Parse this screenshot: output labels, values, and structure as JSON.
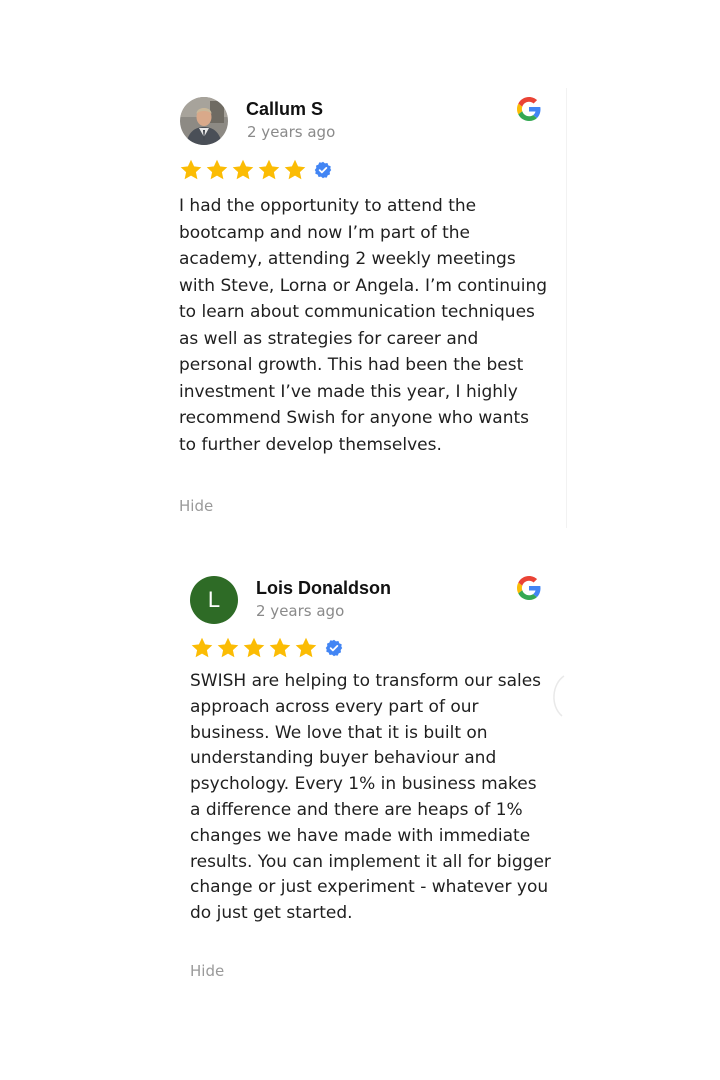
{
  "reviews": [
    {
      "author": "Callum S",
      "date": "2 years ago",
      "rating": 5,
      "verified_icon": "verified-badge-icon",
      "source_icon": "google-logo-icon",
      "text": "I had the opportunity to attend the bootcamp and now I’m part of the academy, attending 2 weekly meetings with Steve, Lorna or Angela. I’m continuing to learn about communication techniques as well as strategies for career and personal growth. This had been the best investment I’ve made this year, I highly recommend Swish for anyone who wants to further develop themselves.",
      "hide_label": "Hide"
    },
    {
      "author": "Lois Donaldson",
      "date": "2 years ago",
      "avatar_letter": "L",
      "avatar_color": "#2e6b26",
      "rating": 5,
      "verified_icon": "verified-badge-icon",
      "source_icon": "google-logo-icon",
      "text": "SWISH are helping to transform our sales approach across every part of our business. We love that it is built on understanding buyer behaviour and psychology. Every 1% in business makes a difference and there are heaps of 1% changes we have made with immediate results. You can implement it all for bigger change or just experiment - whatever you do just get started.",
      "hide_label": "Hide"
    }
  ],
  "colors": {
    "star": "#fbbc04",
    "verified": "#4285f4",
    "hide_text": "#9a9a9a",
    "date_text": "#8a8a8a"
  }
}
